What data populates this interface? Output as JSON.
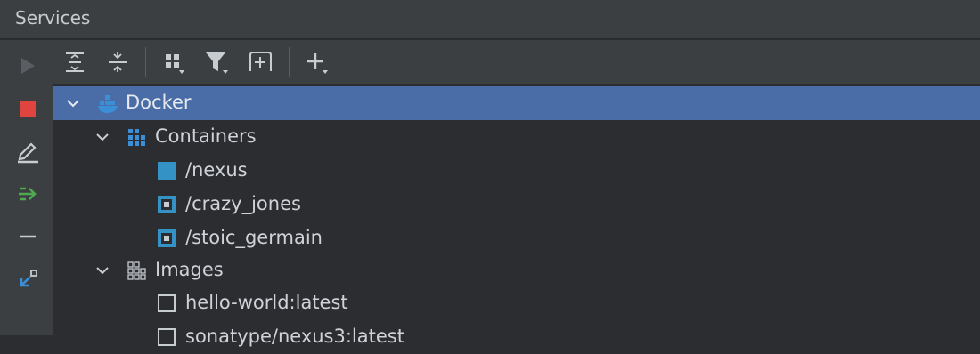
{
  "panel": {
    "title": "Services"
  },
  "left_toolbar": [
    {
      "icon": "run-icon"
    },
    {
      "icon": "stop-icon"
    },
    {
      "icon": "edit-icon"
    },
    {
      "icon": "deploy-icon"
    },
    {
      "icon": "minus-icon"
    },
    {
      "icon": "restore-layout-icon"
    }
  ],
  "top_toolbar": [
    {
      "icon": "expand-all-icon"
    },
    {
      "icon": "collapse-all-icon"
    },
    {
      "icon": "group-by-icon"
    },
    {
      "icon": "filter-icon"
    },
    {
      "icon": "new-tab-icon"
    },
    {
      "icon": "add-icon"
    }
  ],
  "tree": {
    "root": {
      "label": "Docker",
      "expanded": true,
      "selected": true
    },
    "containers": {
      "label": "Containers",
      "expanded": true,
      "items": [
        "/nexus",
        "/crazy_jones",
        "/stoic_germain"
      ]
    },
    "images": {
      "label": "Images",
      "expanded": true,
      "items": [
        "hello-world:latest",
        "sonatype/nexus3:latest"
      ]
    }
  },
  "colors": {
    "selection": "#4a6da7",
    "stop": "#e0443e",
    "deploy": "#4fa94f",
    "container_running": "#3592c4",
    "docker_blue": "#3a8fd6"
  }
}
